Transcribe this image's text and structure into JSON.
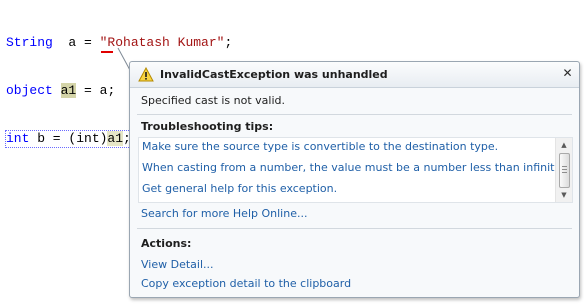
{
  "code": {
    "line1": {
      "kw": "String",
      "rest_a": "  a = ",
      "str": "\"Rohatash Kumar\"",
      "end": ";"
    },
    "line2": {
      "kw": "object",
      "sp": " ",
      "ident": "a1",
      "rest": " = a;"
    },
    "line3": {
      "kw": "int",
      "rest": " b = (int)",
      "ident": "a1",
      "end": ";"
    }
  },
  "popup": {
    "title": "InvalidCastException was unhandled",
    "close_glyph": "✕",
    "message": "Specified cast is not valid.",
    "troubleshooting_title": "Troubleshooting tips:",
    "tips": [
      "Make sure the source type is convertible to the destination type.",
      "When casting from a number, the value must be a number less than infinity.",
      "Get general help for this exception."
    ],
    "search_link": "Search for more Help Online...",
    "actions_title": "Actions:",
    "actions": [
      "View Detail...",
      "Copy exception detail to the clipboard"
    ]
  },
  "icons": {
    "warning": "warning-triangle-icon",
    "close": "close-icon"
  },
  "colors": {
    "keyword": "#0000ff",
    "string": "#a31515",
    "link": "#1f5fa7",
    "error_squiggle": "#e00000"
  }
}
